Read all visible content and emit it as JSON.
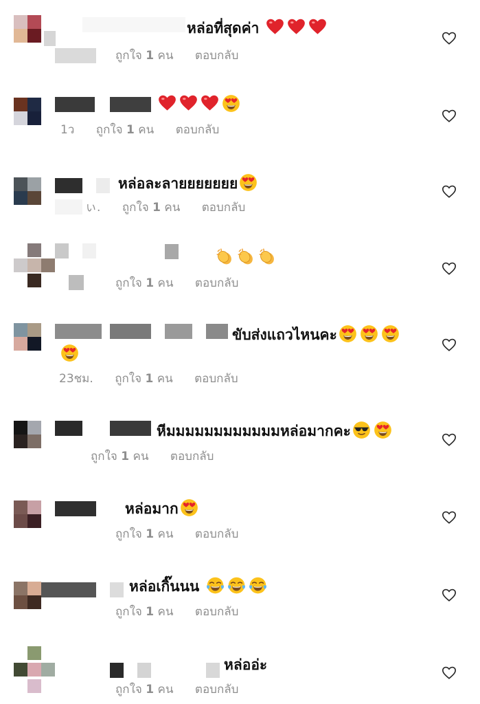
{
  "labels": {
    "like": "ถูกใจ",
    "like_count": "1",
    "like_unit": "คน",
    "reply": "ตอบกลับ"
  },
  "comments": [
    {
      "text": "หล่อที่สุดค่า",
      "time": "",
      "emojis": [
        "heart",
        "heart",
        "heart"
      ]
    },
    {
      "text": "",
      "time": "1ว",
      "emojis": [
        "heart",
        "heart",
        "heart",
        "heart-eyes"
      ]
    },
    {
      "text": "หล่อละลายยยยยยย",
      "time": "ぃ.",
      "emojis": [
        "heart-eyes"
      ]
    },
    {
      "text": "",
      "time": "",
      "emojis": [
        "clap",
        "clap",
        "clap"
      ]
    },
    {
      "text": "ขับส่งแถวไหนคะ",
      "time": "23ชม.",
      "emojis": [
        "heart-eyes",
        "heart-eyes",
        "heart-eyes",
        "heart-eyes"
      ]
    },
    {
      "text": "หีมมมมมมมมมมมมหล่อมากคะ",
      "time": "",
      "emojis": [
        "sunglasses",
        "heart-eyes"
      ]
    },
    {
      "text": "หล่อมาก",
      "time": "",
      "emojis": [
        "heart-eyes"
      ]
    },
    {
      "text": "หล่อเกิ๊นนน",
      "time": "",
      "emojis": [
        "joy",
        "joy",
        "joy"
      ]
    },
    {
      "text": "หล่ออ่ะ",
      "time": "",
      "emojis": []
    }
  ]
}
